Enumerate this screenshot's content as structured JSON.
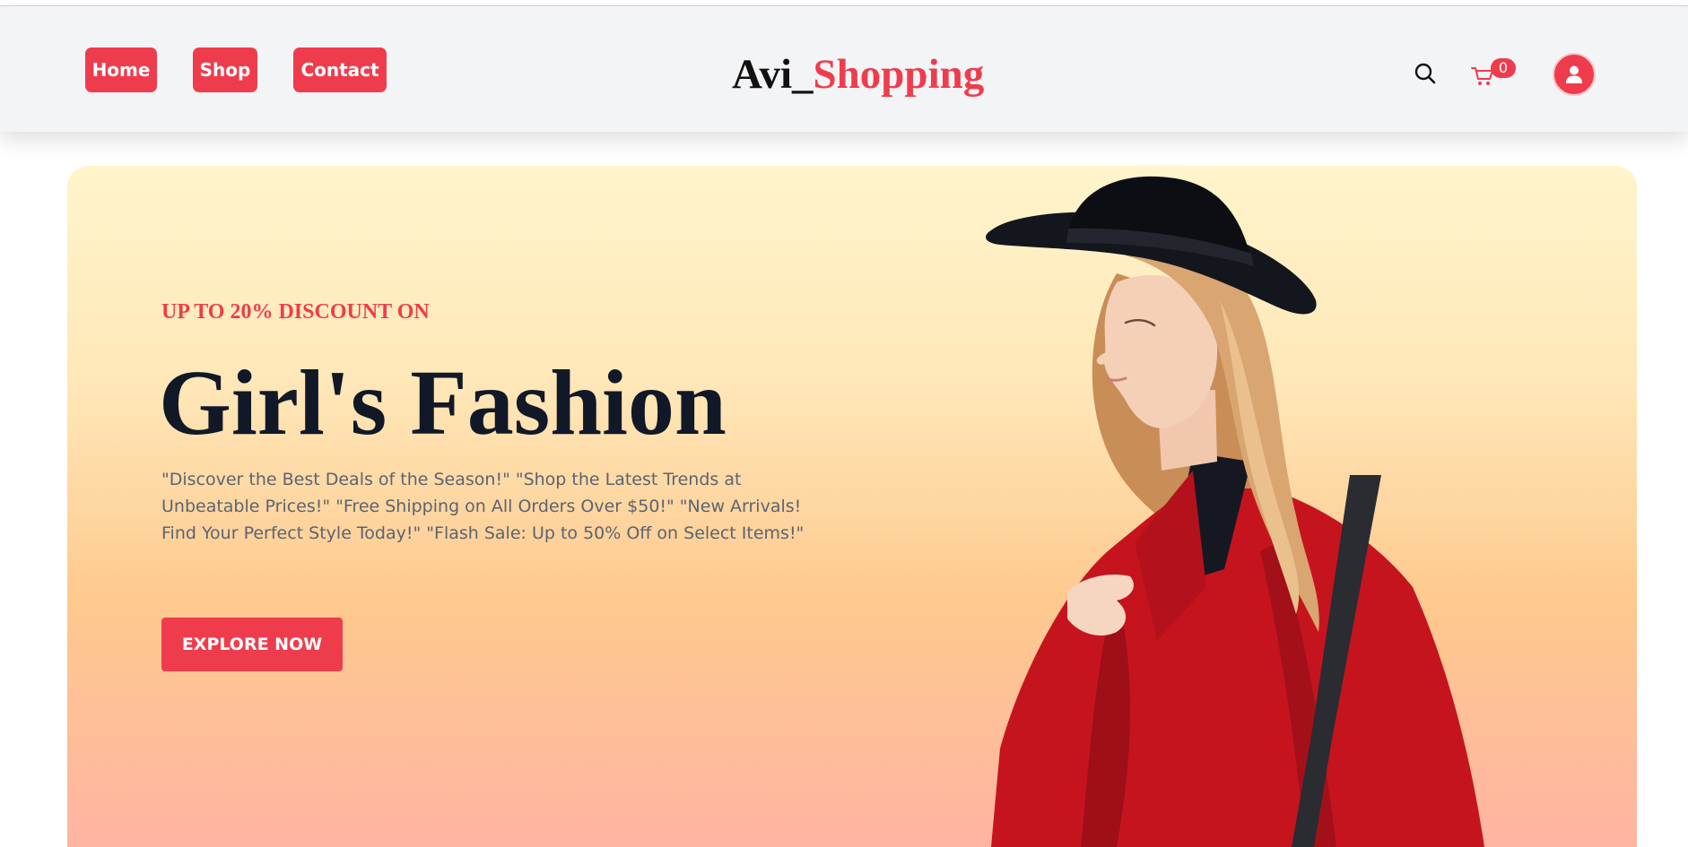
{
  "nav": {
    "links": [
      "Home",
      "Shop",
      "Contact"
    ]
  },
  "brand": {
    "part1": "Avi_",
    "part2": "Shopping"
  },
  "cart": {
    "count": "0"
  },
  "icons": {
    "search": "search-icon",
    "cart": "cart-icon",
    "user": "user-icon"
  },
  "hero": {
    "subtitle": "UP TO 20% DISCOUNT ON",
    "title": "Girl's Fashion",
    "description": "\"Discover the Best Deals of the Season!\" \"Shop the Latest Trends at Unbeatable Prices!\" \"Free Shipping on All Orders Over $50!\" \"New Arrivals! Find Your Perfect Style Today!\" \"Flash Sale: Up to 50% Off on Select Items!\"",
    "button": "EXPLORE NOW"
  },
  "colors": {
    "accent": "#ef3c4d",
    "navbar_bg": "#f3f4f6",
    "title": "#111827",
    "description": "#5b6472",
    "hero_top": "#fff4cb",
    "hero_bottom": "#ffb4a2"
  }
}
